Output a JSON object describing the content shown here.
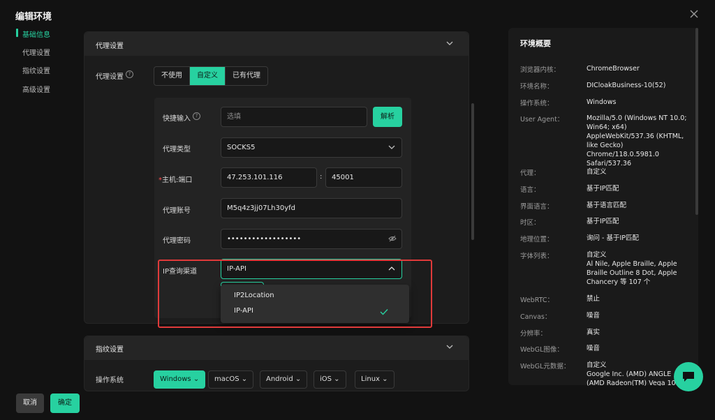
{
  "window": {
    "title": "编辑环境"
  },
  "sidenav": {
    "items": [
      {
        "label": "基础信息",
        "active": true
      },
      {
        "label": "代理设置",
        "active": false
      },
      {
        "label": "指纹设置",
        "active": false
      },
      {
        "label": "高级设置",
        "active": false
      }
    ]
  },
  "proxy_section": {
    "title": "代理设置",
    "field_label": "代理设置",
    "modes": [
      "不使用",
      "自定义",
      "已有代理"
    ],
    "selected_mode": "自定义",
    "quick_input": {
      "label": "快捷输入",
      "placeholder": "选填",
      "parse_button": "解析"
    },
    "proxy_type": {
      "label": "代理类型",
      "value": "SOCKS5"
    },
    "host_port": {
      "label": "主机:端口",
      "required_mark": "*",
      "host": "47.253.101.116",
      "separator": ":",
      "port": "45001"
    },
    "account": {
      "label": "代理账号",
      "value": "M5q4z3jj07Lh30yfd"
    },
    "password": {
      "label": "代理密码",
      "value": "••••••••••••••••••"
    },
    "ip_channel": {
      "label": "IP查询渠道",
      "value": "IP-API",
      "options": [
        {
          "label": "IP2Location",
          "selected": false
        },
        {
          "label": "IP-API",
          "selected": true
        }
      ]
    }
  },
  "fingerprint_section": {
    "title": "指纹设置",
    "os_label": "操作系统",
    "os_options": [
      "Windows",
      "macOS",
      "Android",
      "iOS",
      "Linux"
    ],
    "selected_os": "Windows"
  },
  "summary": {
    "title": "环境概要",
    "rows": [
      {
        "key": "浏览器内核：",
        "value": "ChromeBrowser"
      },
      {
        "key": "环境名称：",
        "value": "DICloakBusiness-10(52)"
      },
      {
        "key": "操作系统：",
        "value": "Windows"
      },
      {
        "key": "User Agent：",
        "value": "Mozilla/5.0 (Windows NT 10.0; Win64; x64) AppleWebKit/537.36 (KHTML, like Gecko) Chrome/118.0.5981.0 Safari/537.36"
      },
      {
        "key": "代理：",
        "value": "自定义"
      },
      {
        "key": "语言：",
        "value": "基于IP匹配"
      },
      {
        "key": "界面语言：",
        "value": "基于语言匹配"
      },
      {
        "key": "时区：",
        "value": "基于IP匹配"
      },
      {
        "key": "地理位置：",
        "value": "询问 - 基于IP匹配"
      },
      {
        "key": "字体列表：",
        "value": "自定义\nAl Nile, Apple Braille, Apple Braille Outline 8 Dot, Apple Chancery 等 107 个"
      },
      {
        "key": "WebRTC：",
        "value": "禁止"
      },
      {
        "key": "Canvas：",
        "value": "噪音"
      },
      {
        "key": "分辨率：",
        "value": "真实"
      },
      {
        "key": "WebGL图像：",
        "value": "噪音"
      },
      {
        "key": "WebGL元数据：",
        "value": "自定义\nGoogle Inc. (AMD) ANGLE (AMD Radeon(TM) Vega 10"
      }
    ]
  },
  "footer": {
    "cancel": "取消",
    "confirm": "确定"
  },
  "colors": {
    "accent": "#27d1a0",
    "highlight_box": "#e03a3a"
  }
}
